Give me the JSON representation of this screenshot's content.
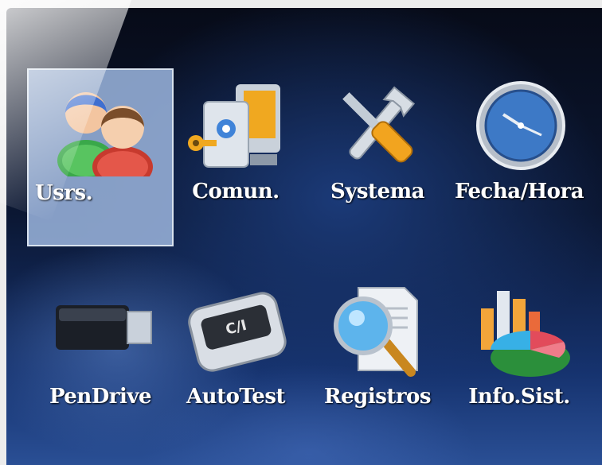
{
  "menu": {
    "items": [
      {
        "label": "Usrs.",
        "icon": "users-icon",
        "selected": true
      },
      {
        "label": "Comun.",
        "icon": "communication-icon",
        "selected": false
      },
      {
        "label": "Systema",
        "icon": "tools-icon",
        "selected": false
      },
      {
        "label": "Fecha/Hora",
        "icon": "clock-icon",
        "selected": false
      },
      {
        "label": "PenDrive",
        "icon": "usb-drive-icon",
        "selected": false
      },
      {
        "label": "AutoTest",
        "icon": "autotest-icon",
        "selected": false
      },
      {
        "label": "Registros",
        "icon": "records-search-icon",
        "selected": false
      },
      {
        "label": "Info.Sist.",
        "icon": "system-info-chart-icon",
        "selected": false
      }
    ]
  },
  "autotest_icon_text": "C/I",
  "colors": {
    "selection_bg": "#91aad2",
    "screen_dark": "#0b1733",
    "screen_light": "#2a4f95",
    "label": "#ffffff"
  }
}
